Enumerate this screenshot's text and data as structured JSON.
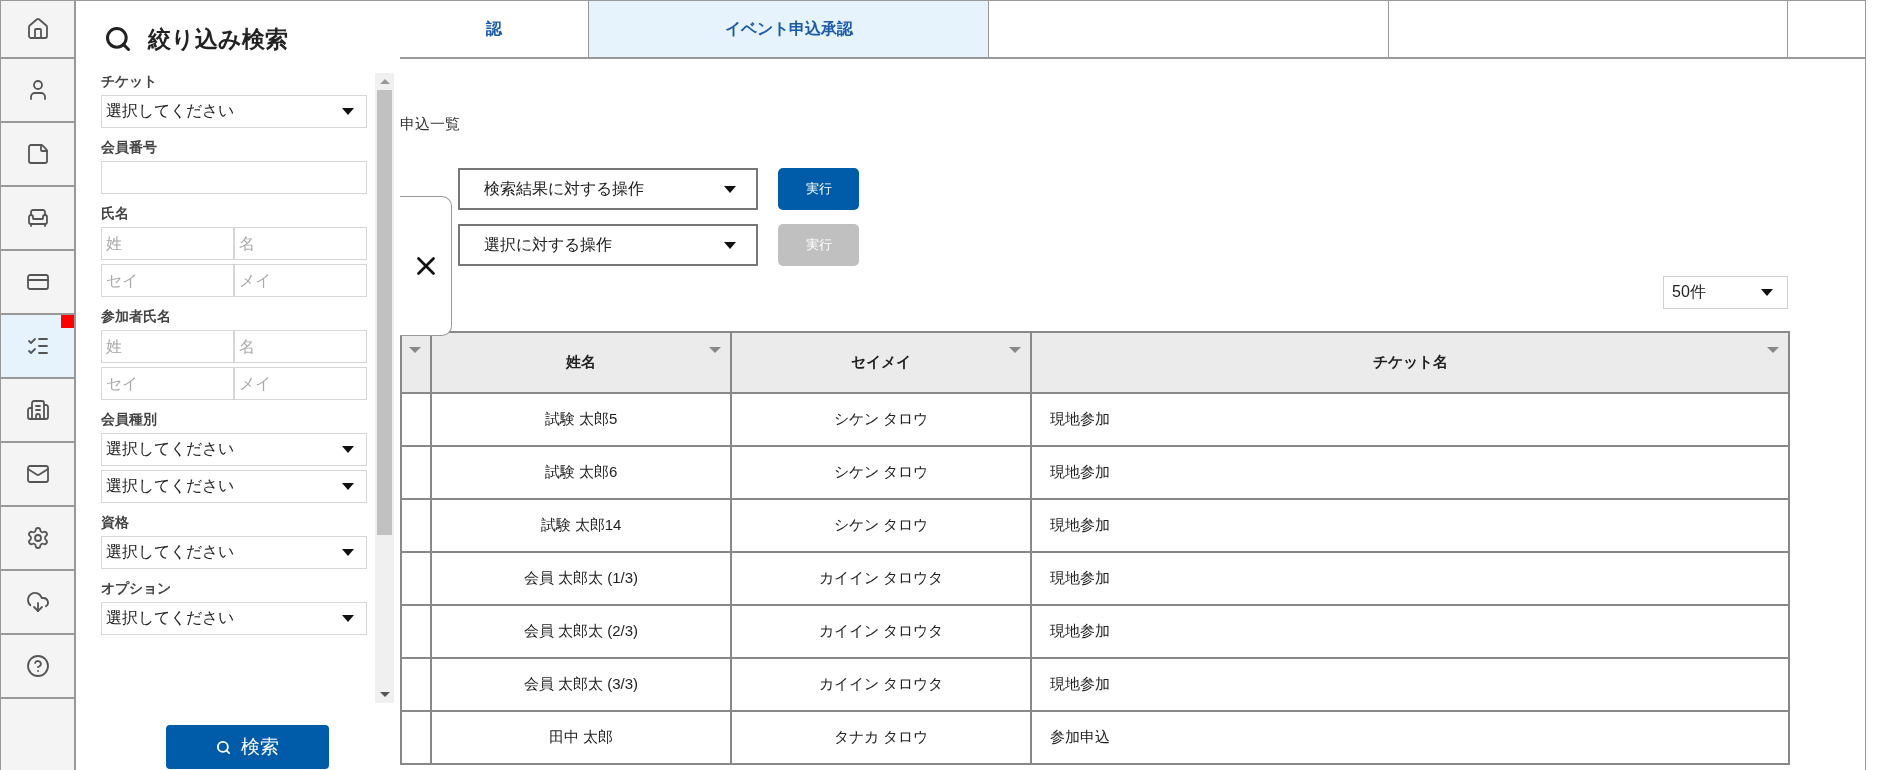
{
  "rail": [
    {
      "selected": false,
      "notice": false
    },
    {
      "selected": false,
      "notice": false
    },
    {
      "selected": false,
      "notice": false
    },
    {
      "selected": false,
      "notice": false
    },
    {
      "selected": false,
      "notice": false
    },
    {
      "selected": true,
      "notice": true
    },
    {
      "selected": false,
      "notice": false
    },
    {
      "selected": false,
      "notice": false
    },
    {
      "selected": false,
      "notice": false
    },
    {
      "selected": false,
      "notice": false
    },
    {
      "selected": false,
      "notice": false
    }
  ],
  "filter_panel": {
    "title": "絞り込み検索",
    "search_button": "検索",
    "filters": [
      {
        "kind": "select",
        "label": "チケット",
        "values": [
          "選択してください"
        ]
      },
      {
        "kind": "text",
        "label": "会員番号"
      },
      {
        "kind": "name",
        "label": "氏名",
        "rows": [
          [
            {
              "placeholder": "姓"
            },
            {
              "placeholder": "名"
            }
          ],
          [
            {
              "placeholder": "セイ"
            },
            {
              "placeholder": "メイ"
            }
          ]
        ]
      },
      {
        "kind": "name",
        "label": "参加者氏名",
        "rows": [
          [
            {
              "placeholder": "姓"
            },
            {
              "placeholder": "名"
            }
          ],
          [
            {
              "placeholder": "セイ"
            },
            {
              "placeholder": "メイ"
            }
          ]
        ]
      },
      {
        "kind": "select",
        "label": "会員種別",
        "values": [
          "選択してください",
          "選択してください"
        ]
      },
      {
        "kind": "select",
        "label": "資格",
        "values": [
          "選択してください"
        ]
      },
      {
        "kind": "select",
        "label": "オプション",
        "values": [
          "選択してください"
        ]
      }
    ]
  },
  "tabs": [
    {
      "label": "認",
      "selected": false
    },
    {
      "label": "イベント申込承認",
      "selected": true
    },
    {
      "selected": false
    },
    {
      "selected": false
    }
  ],
  "page_title": "申込一覧",
  "actions": [
    {
      "select": "検索結果に対する操作",
      "button": "実行",
      "disabled": false
    },
    {
      "select": "選択に対する操作",
      "button": "実行",
      "disabled": true
    }
  ],
  "page_size": "50件",
  "table": {
    "columns": [
      {
        "sortable": true
      },
      {
        "label": "姓名",
        "sortable": true
      },
      {
        "label": "セイメイ",
        "sortable": true
      },
      {
        "label": "チケット名",
        "sortable": true
      }
    ],
    "rows": [
      [
        "",
        "試験 太郎5",
        "シケン タロウ",
        "現地参加"
      ],
      [
        "",
        "試験 太郎6",
        "シケン タロウ",
        "現地参加"
      ],
      [
        "",
        "試験 太郎14",
        "シケン タロウ",
        "現地参加"
      ],
      [
        "",
        "会員 太郎太 (1/3)",
        "カイイン タロウタ",
        "現地参加"
      ],
      [
        "",
        "会員 太郎太 (2/3)",
        "カイイン タロウタ",
        "現地参加"
      ],
      [
        "",
        "会員 太郎太 (3/3)",
        "カイイン タロウタ",
        "現地参加"
      ],
      [
        "",
        "田中 太郎",
        "タナカ タロウ",
        "参加申込"
      ]
    ]
  }
}
